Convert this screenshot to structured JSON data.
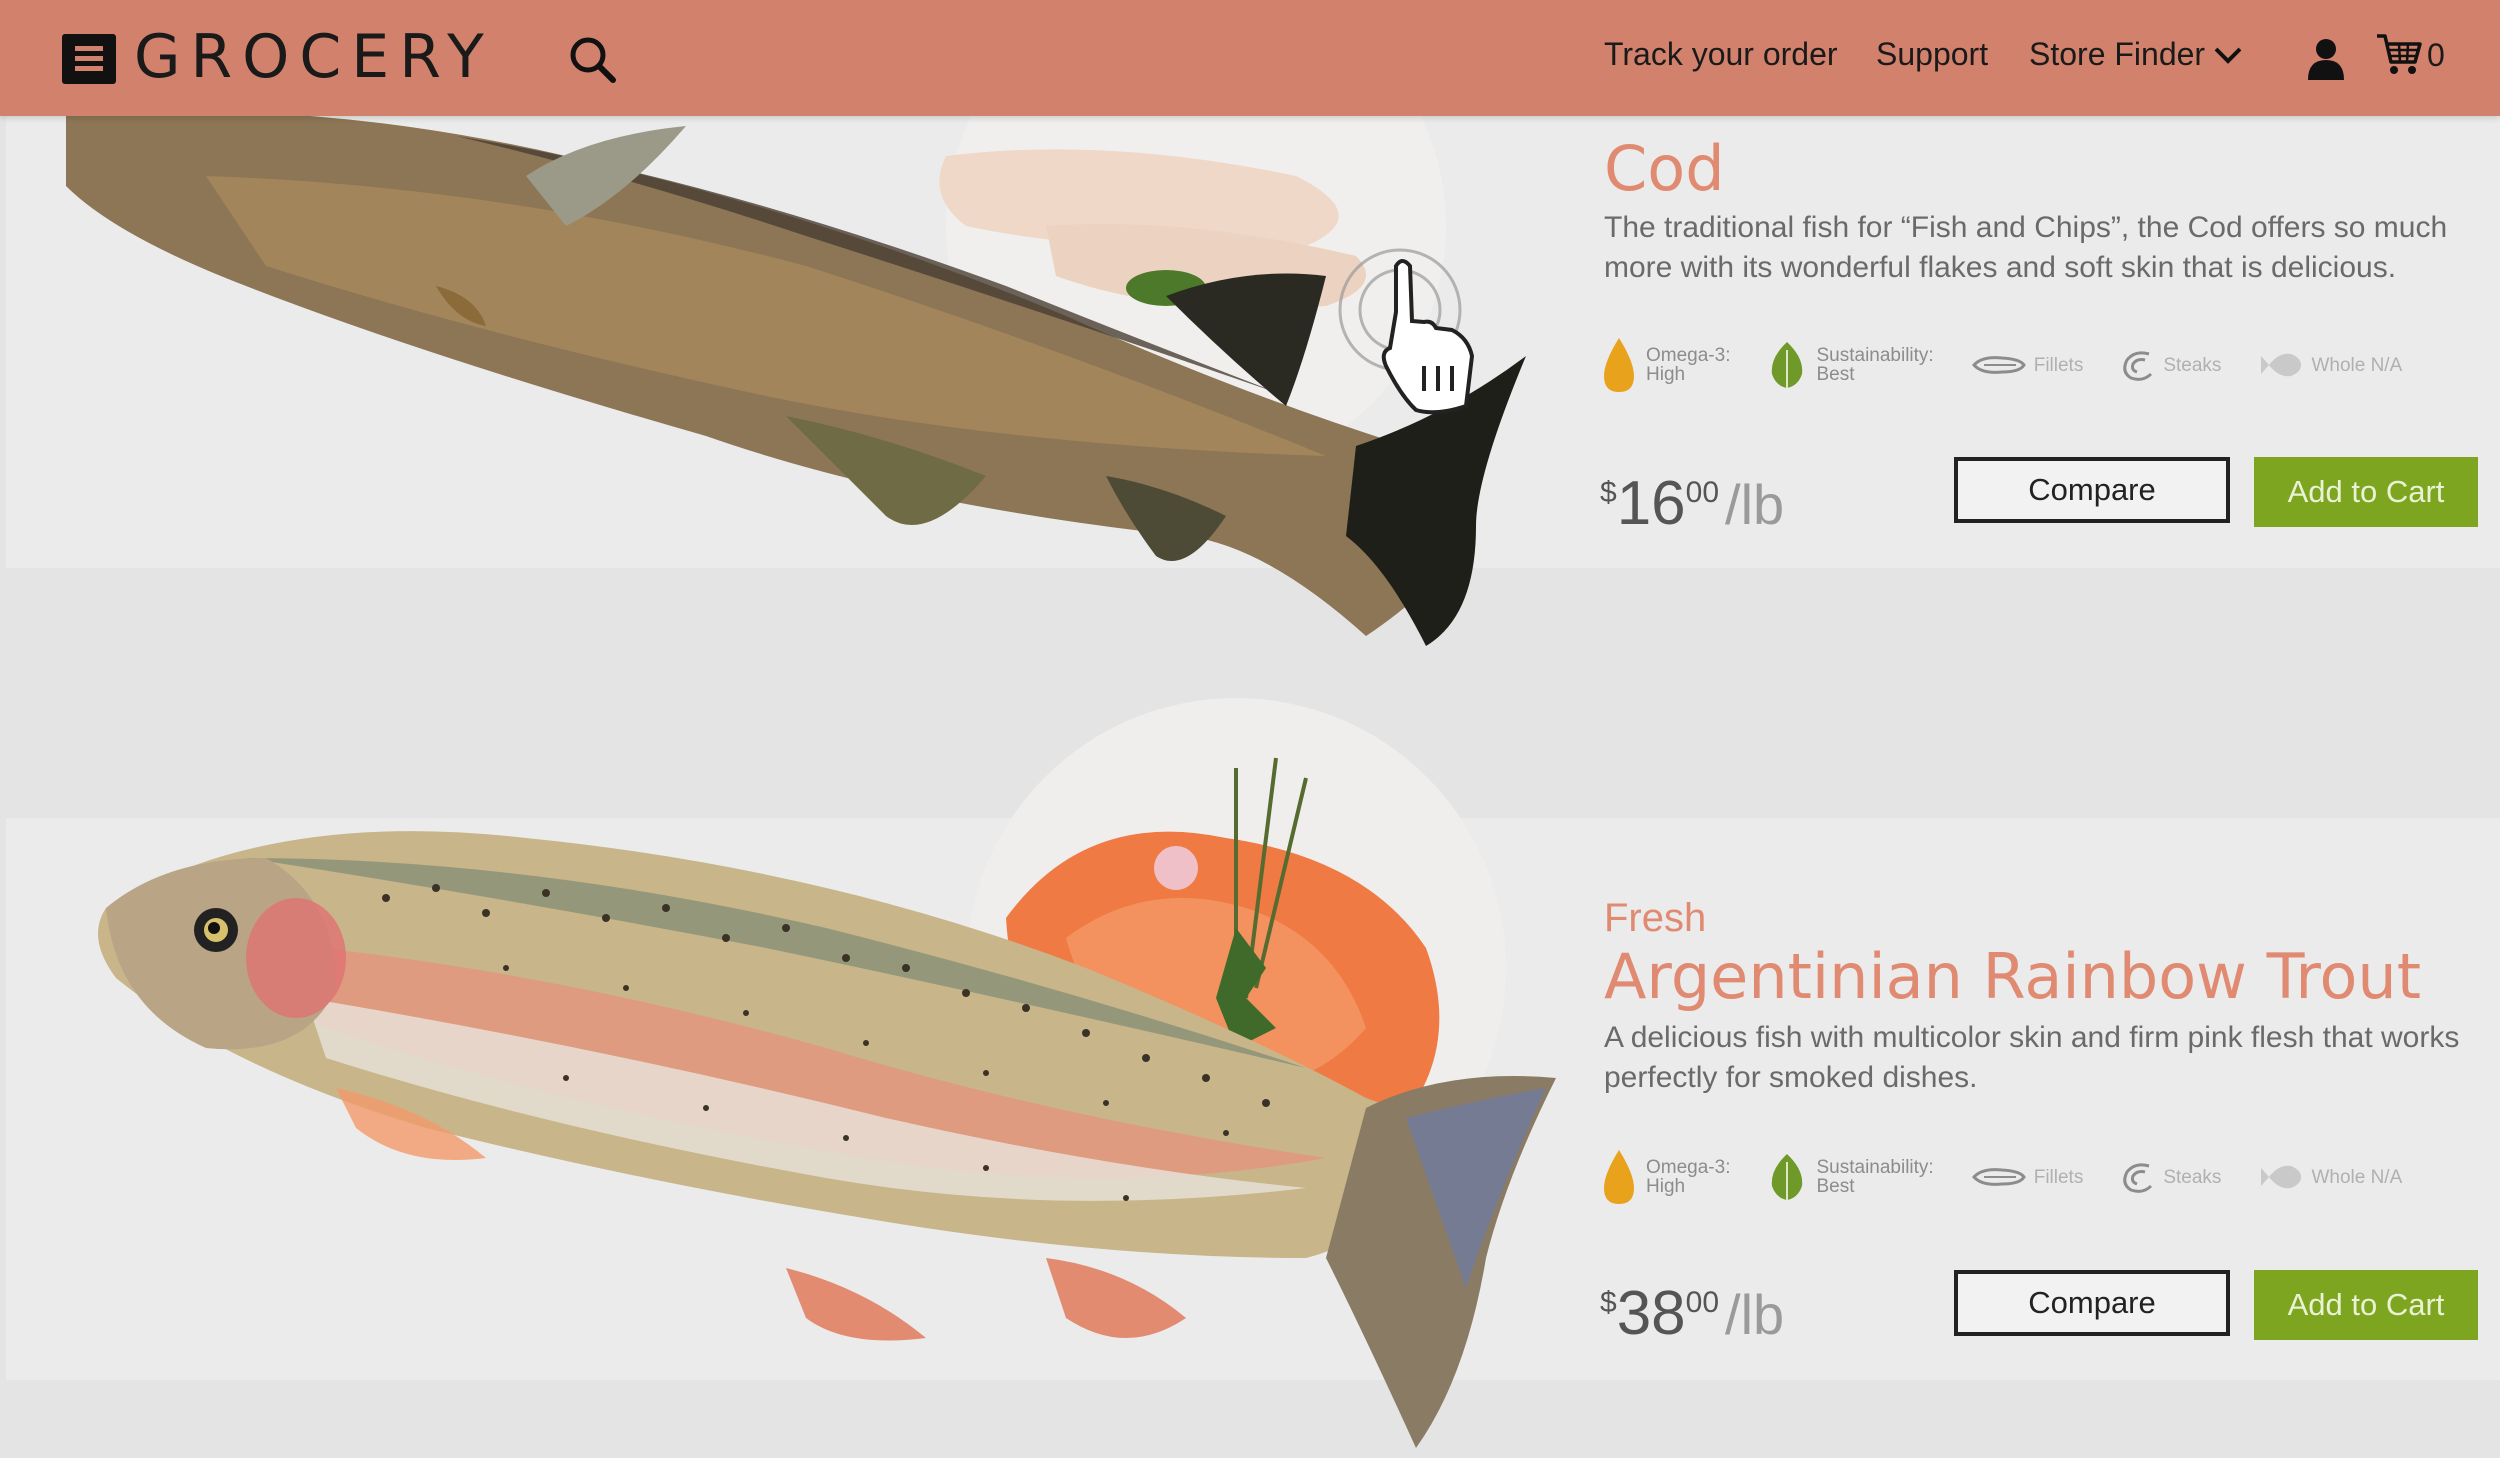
{
  "header": {
    "logo": "GROCERY",
    "nav": {
      "track_order": "Track your order",
      "support": "Support",
      "store_finder": "Store Finder"
    },
    "cart_count": "0"
  },
  "products": [
    {
      "name": "Cod",
      "description": "The traditional fish for “Fish and Chips”, the Cod offers so much more with its wonderful flakes and soft skin that is delicious.",
      "attributes": {
        "omega_label": "Omega-3:",
        "omega_value": "High",
        "sustain_label": "Sustainability:",
        "sustain_value": "Best",
        "fillets": "Fillets",
        "steaks": "Steaks",
        "whole": "Whole N/A"
      },
      "price": {
        "currency": "$",
        "dollars": "16",
        "cents": "00",
        "unit": "/lb"
      },
      "compare_label": "Compare",
      "add_label": "Add to Cart"
    },
    {
      "category": "Fresh",
      "name": "Argentinian Rainbow Trout",
      "description": "A delicious fish with multicolor skin and firm pink flesh that works perfectly for smoked dishes.",
      "attributes": {
        "omega_label": "Omega-3:",
        "omega_value": "High",
        "sustain_label": "Sustainability:",
        "sustain_value": "Best",
        "fillets": "Fillets",
        "steaks": "Steaks",
        "whole": "Whole N/A"
      },
      "price": {
        "currency": "$",
        "dollars": "38",
        "cents": "00",
        "unit": "/lb"
      },
      "compare_label": "Compare",
      "add_label": "Add to Cart"
    }
  ],
  "colors": {
    "header_bg": "#d2826c",
    "accent_text": "#e08a72",
    "add_to_cart_bg": "#7ea51f",
    "omega_icon": "#e8a21c",
    "leaf_icon": "#6f9a2a"
  },
  "icons": [
    "menu-icon",
    "search-icon",
    "chevron-down-icon",
    "user-icon",
    "cart-icon",
    "omega-drop-icon",
    "leaf-icon",
    "fillet-icon",
    "steak-icon",
    "whole-fish-icon",
    "hand-pointer-icon"
  ]
}
